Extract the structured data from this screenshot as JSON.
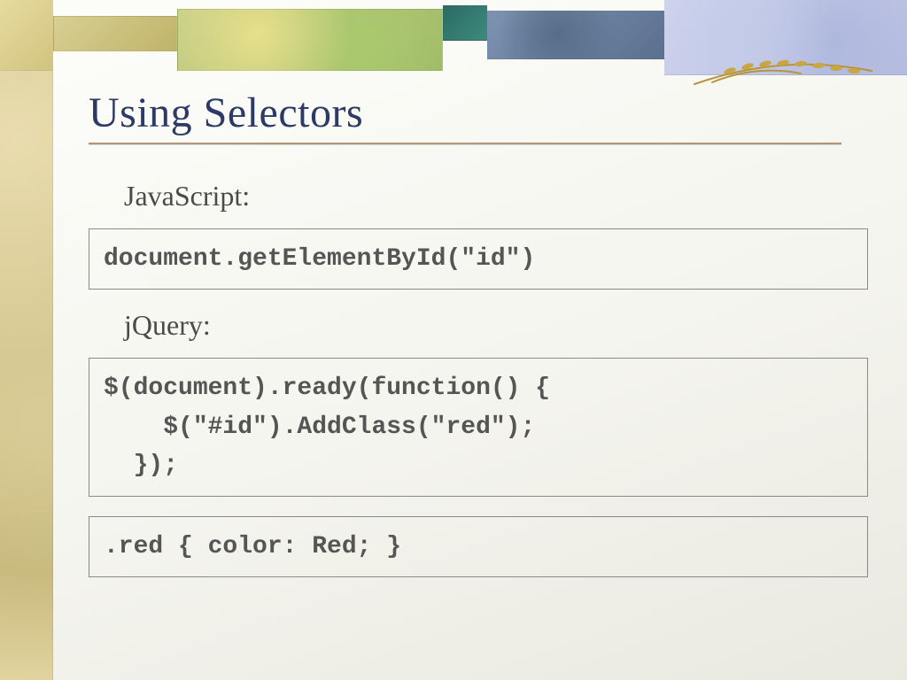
{
  "slide": {
    "title": "Using Selectors",
    "sections": {
      "javascript": {
        "label": "JavaScript:",
        "code": "document.getElementById(\"id\")"
      },
      "jquery": {
        "label": "jQuery:",
        "code": "$(document).ready(function() {\n    $(\"#id\").AddClass(\"red\");\n  });"
      },
      "css": {
        "code": ".red { color: Red; }"
      }
    }
  }
}
